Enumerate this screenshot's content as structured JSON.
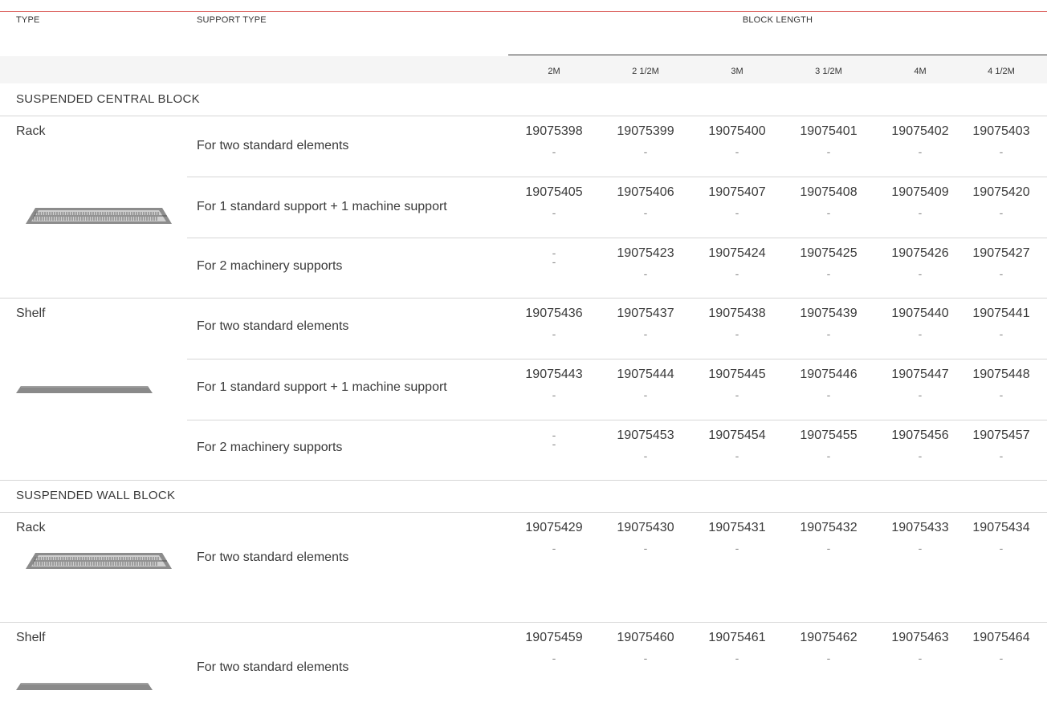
{
  "header": {
    "type_label": "TYPE",
    "support_label": "SUPPORT TYPE",
    "block_length_label": "BLOCK LENGTH",
    "lengths": [
      "2M",
      "2 1/2M",
      "3M",
      "3 1/2M",
      "4M",
      "4 1/2M"
    ]
  },
  "sections": [
    {
      "title": "SUSPENDED CENTRAL BLOCK",
      "groups": [
        {
          "type": "Rack",
          "icon": "rack-icon",
          "rows": [
            {
              "support": "For two standard elements",
              "cells": [
                [
                  "19075398",
                  "-"
                ],
                [
                  "19075399",
                  "-"
                ],
                [
                  "19075400",
                  "-"
                ],
                [
                  "19075401",
                  "-"
                ],
                [
                  "19075402",
                  "-"
                ],
                [
                  "19075403",
                  "-"
                ]
              ]
            },
            {
              "support": "For 1 standard support + 1 machine support",
              "cells": [
                [
                  "19075405",
                  "-"
                ],
                [
                  "19075406",
                  "-"
                ],
                [
                  "19075407",
                  "-"
                ],
                [
                  "19075408",
                  "-"
                ],
                [
                  "19075409",
                  "-"
                ],
                [
                  "19075420",
                  "-"
                ]
              ]
            },
            {
              "support": "For 2 machinery supports",
              "cells": [
                [
                  "-",
                  "-"
                ],
                [
                  "19075423",
                  "-"
                ],
                [
                  "19075424",
                  "-"
                ],
                [
                  "19075425",
                  "-"
                ],
                [
                  "19075426",
                  "-"
                ],
                [
                  "19075427",
                  "-"
                ]
              ]
            }
          ]
        },
        {
          "type": "Shelf",
          "icon": "shelf-icon",
          "rows": [
            {
              "support": "For two standard elements",
              "cells": [
                [
                  "19075436",
                  "-"
                ],
                [
                  "19075437",
                  "-"
                ],
                [
                  "19075438",
                  "-"
                ],
                [
                  "19075439",
                  "-"
                ],
                [
                  "19075440",
                  "-"
                ],
                [
                  "19075441",
                  "-"
                ]
              ]
            },
            {
              "support": "For 1 standard support + 1 machine support",
              "cells": [
                [
                  "19075443",
                  "-"
                ],
                [
                  "19075444",
                  "-"
                ],
                [
                  "19075445",
                  "-"
                ],
                [
                  "19075446",
                  "-"
                ],
                [
                  "19075447",
                  "-"
                ],
                [
                  "19075448",
                  "-"
                ]
              ]
            },
            {
              "support": "For 2 machinery supports",
              "cells": [
                [
                  "-",
                  "-"
                ],
                [
                  "19075453",
                  "-"
                ],
                [
                  "19075454",
                  "-"
                ],
                [
                  "19075455",
                  "-"
                ],
                [
                  "19075456",
                  "-"
                ],
                [
                  "19075457",
                  "-"
                ]
              ]
            }
          ]
        }
      ]
    },
    {
      "title": "SUSPENDED WALL BLOCK",
      "groups": [
        {
          "type": "Rack",
          "icon": "rack-icon",
          "rows": [
            {
              "support": "For two standard elements",
              "cells": [
                [
                  "19075429",
                  "-"
                ],
                [
                  "19075430",
                  "-"
                ],
                [
                  "19075431",
                  "-"
                ],
                [
                  "19075432",
                  "-"
                ],
                [
                  "19075433",
                  "-"
                ],
                [
                  "19075434",
                  "-"
                ]
              ]
            }
          ]
        },
        {
          "type": "Shelf",
          "icon": "shelf-icon",
          "rows": [
            {
              "support": "For two standard elements",
              "cells": [
                [
                  "19075459",
                  "-"
                ],
                [
                  "19075460",
                  "-"
                ],
                [
                  "19075461",
                  "-"
                ],
                [
                  "19075462",
                  "-"
                ],
                [
                  "19075463",
                  "-"
                ],
                [
                  "19075464",
                  "-"
                ]
              ]
            }
          ]
        }
      ]
    }
  ],
  "colors": {
    "accent_line": "#d9534f",
    "header_band": "#f5f5f5",
    "divider": "#d6d6d6"
  }
}
